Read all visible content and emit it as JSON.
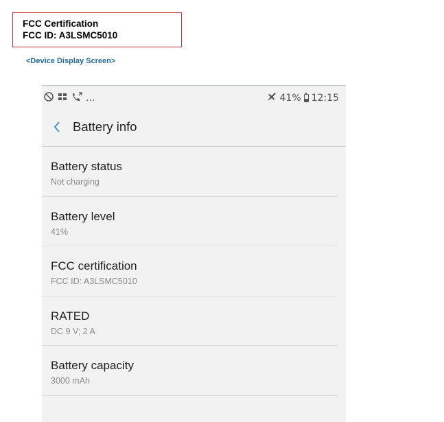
{
  "fcc_label": {
    "line1": "FCC Certification",
    "line2": "FCC ID: A3LSMC5010"
  },
  "caption": "<Device Display Screen>",
  "status_bar": {
    "left_icons": [
      "blocked-icon",
      "sim-icon",
      "call-forward-icon"
    ],
    "overflow": "...",
    "right_icons": [
      "airplane-icon",
      "battery-icon"
    ],
    "battery_percent": "41%",
    "time": "12:15"
  },
  "app_bar": {
    "back_icon": "chevron-left-icon",
    "title": "Battery info"
  },
  "items": [
    {
      "title": "Battery status",
      "subtitle": "Not charging"
    },
    {
      "title": "Battery level",
      "subtitle": "41%"
    },
    {
      "title": "FCC certification",
      "subtitle": "FCC ID: A3LSMC5010"
    },
    {
      "title": "RATED",
      "subtitle": "DC 9 V; 2 A"
    },
    {
      "title": "Battery capacity",
      "subtitle": "3000 mAh"
    }
  ],
  "colors": {
    "label_border": "#c8323a",
    "caption": "#1f6aa5",
    "back_icon": "#4a90c8",
    "screen_bg": "#f2f2f2"
  }
}
